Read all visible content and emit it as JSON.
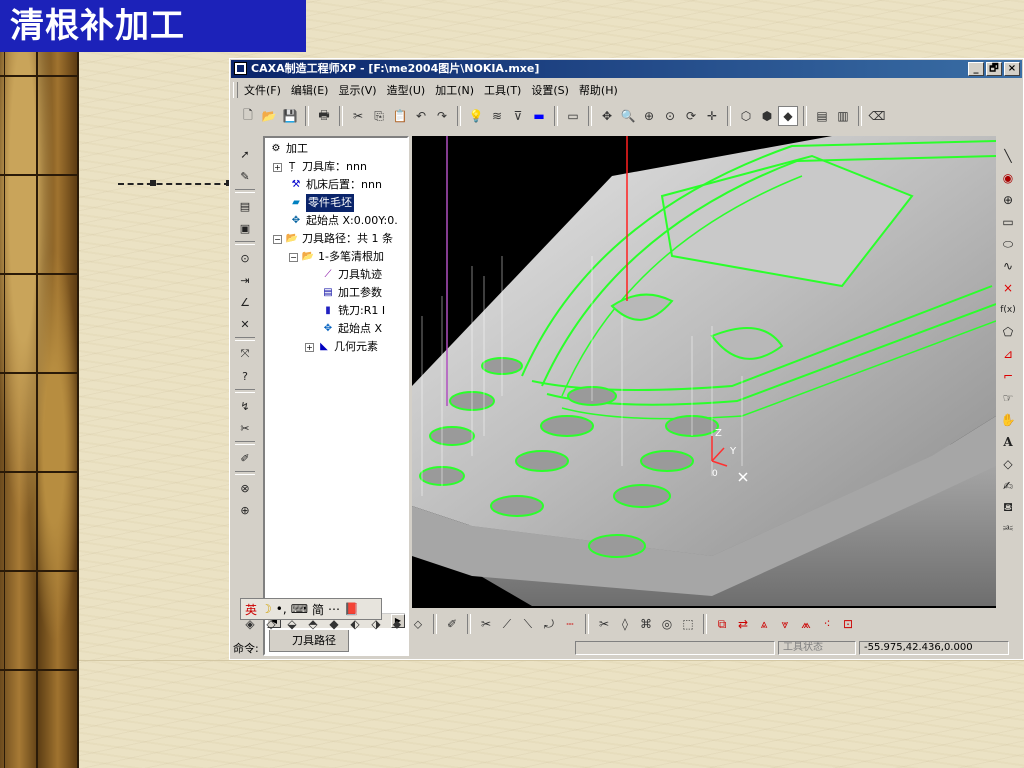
{
  "slide": {
    "title": "清根补加工"
  },
  "window": {
    "title": "CAXA制造工程师XP - [F:\\me2004图片\\NOKIA.mxe]",
    "controls": [
      "_",
      "🗗",
      "×"
    ]
  },
  "menu": {
    "items": [
      "文件(F)",
      "编辑(E)",
      "显示(V)",
      "造型(U)",
      "加工(N)",
      "工具(T)",
      "设置(S)",
      "帮助(H)"
    ]
  },
  "tree": {
    "root": "加工",
    "items": [
      {
        "label": "刀具库：nnn",
        "icon": "tool-icon"
      },
      {
        "label": "机床后置：nnn",
        "icon": "machine-icon"
      },
      {
        "label": "零件毛坯",
        "icon": "blank-icon",
        "selected": true
      },
      {
        "label": "起始点 X:0.00Y:0.",
        "icon": "startpoint-icon"
      },
      {
        "label": "刀具路径：共 1 条",
        "icon": "folder-icon"
      },
      {
        "label": "1-多笔清根加",
        "icon": "folder-icon"
      },
      {
        "label": "刀具轨迹",
        "icon": "trajectory-icon"
      },
      {
        "label": "加工参数",
        "icon": "params-icon"
      },
      {
        "label": "铣刀:R1 I",
        "icon": "cutter-icon"
      },
      {
        "label": "起始点 X",
        "icon": "startpoint-icon"
      },
      {
        "label": "几何元素",
        "icon": "geometry-icon"
      }
    ],
    "tab_label": "刀具路径"
  },
  "ime": {
    "lang": "英",
    "mode": "简"
  },
  "viewport": {
    "axis_labels": {
      "z": "Z",
      "y": "Y",
      "origin": "0"
    }
  },
  "status": {
    "command_label": "命令:",
    "tool_state": "工具状态",
    "coords": "-55.975,42.436,0.000"
  },
  "colors": {
    "title_bg": "#1c22b9",
    "toolpath": "#2bff2b",
    "window_title": "#0a246a"
  }
}
